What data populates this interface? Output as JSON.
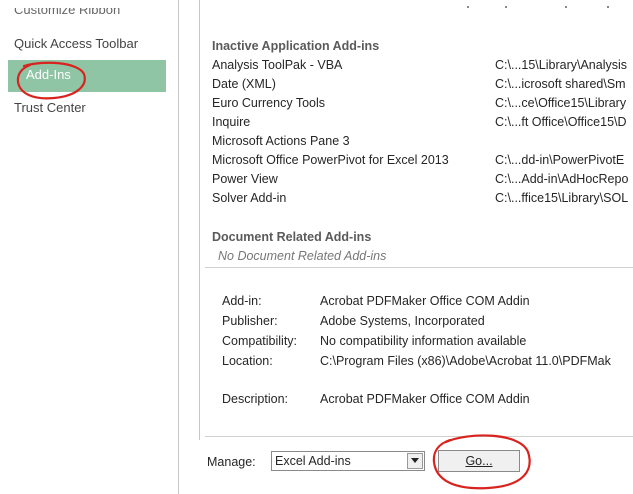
{
  "nav": {
    "customize_ribbon": "Customize Ribbon",
    "quick_access_toolbar": "Quick Access Toolbar",
    "add_ins": "Add-Ins",
    "trust_center": "Trust Center"
  },
  "inactive": {
    "heading": "Inactive Application Add-ins",
    "rows": [
      {
        "name": "Analysis ToolPak - VBA",
        "location": "C:\\...15\\Library\\Analysis"
      },
      {
        "name": "Date (XML)",
        "location": "C:\\...icrosoft shared\\Sm"
      },
      {
        "name": "Euro Currency Tools",
        "location": "C:\\...ce\\Office15\\Library"
      },
      {
        "name": "Inquire",
        "location": "C:\\...ft Office\\Office15\\D"
      },
      {
        "name": "Microsoft Actions Pane 3",
        "location": ""
      },
      {
        "name": "Microsoft Office PowerPivot for Excel 2013",
        "location": "C:\\...dd-in\\PowerPivotE"
      },
      {
        "name": "Power View",
        "location": "C:\\...Add-in\\AdHocRepo"
      },
      {
        "name": "Solver Add-in",
        "location": "C:\\...ffice15\\Library\\SOL"
      }
    ]
  },
  "document": {
    "heading": "Document Related Add-ins",
    "note": "No Document Related Add-ins"
  },
  "details": {
    "addin_label": "Add-in:",
    "addin_value": "Acrobat PDFMaker Office COM Addin",
    "publisher_label": "Publisher:",
    "publisher_value": "Adobe Systems, Incorporated",
    "compat_label": "Compatibility:",
    "compat_value": "No compatibility information available",
    "location_label": "Location:",
    "location_value": "C:\\Program Files (x86)\\Adobe\\Acrobat 11.0\\PDFMak",
    "description_label": "Description:",
    "description_value": "Acrobat PDFMaker Office COM Addin"
  },
  "manage": {
    "label": "Manage:",
    "selected": "Excel Add-ins",
    "go_label": "Go..."
  },
  "colors": {
    "selected_nav_bg": "#8fc4a4",
    "annotation_red": "#d9231f"
  }
}
